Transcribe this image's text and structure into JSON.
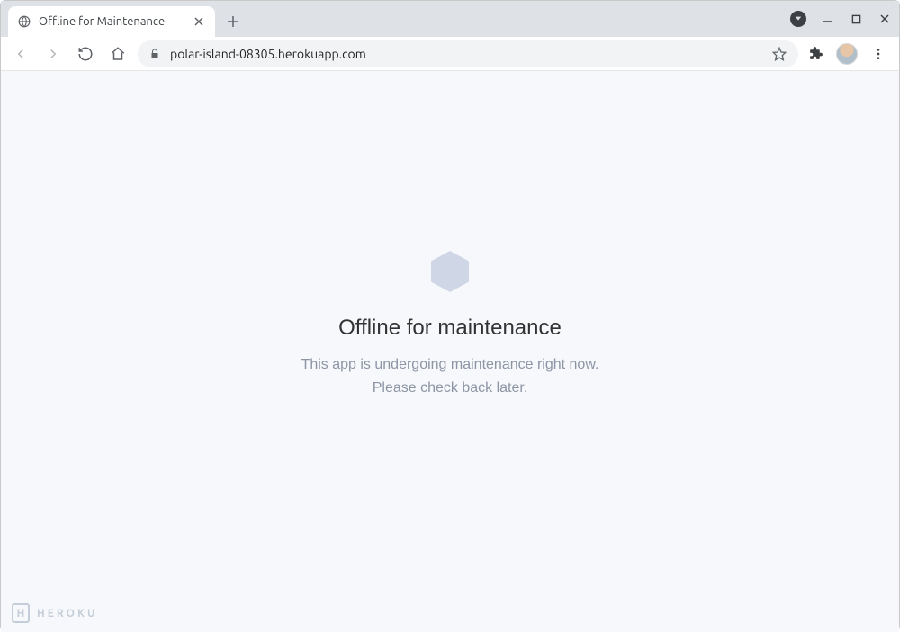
{
  "browser": {
    "tab": {
      "title": "Offline for Maintenance"
    },
    "url": "polar-island-08305.herokuapp.com"
  },
  "page": {
    "heading": "Offline for maintenance",
    "line1": "This app is undergoing maintenance right now.",
    "line2": "Please check back later."
  },
  "footer": {
    "brand_initial": "H",
    "brand_word": "HEROKU"
  }
}
